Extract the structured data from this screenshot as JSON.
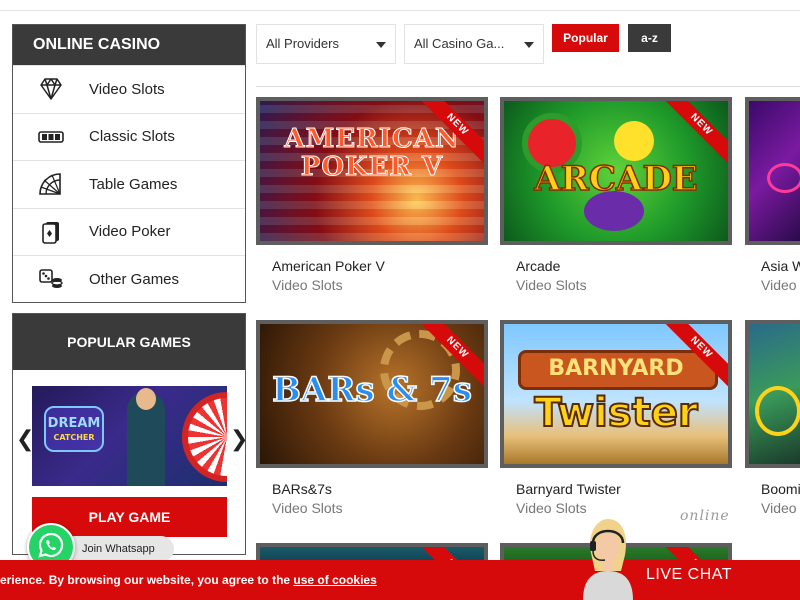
{
  "sidebar": {
    "casino_title": "ONLINE CASINO",
    "categories": [
      {
        "label": "Video Slots",
        "icon": "diamond-icon"
      },
      {
        "label": "Classic Slots",
        "icon": "slot-reels-icon"
      },
      {
        "label": "Table Games",
        "icon": "roulette-icon"
      },
      {
        "label": "Video Poker",
        "icon": "playing-card-icon"
      },
      {
        "label": "Other Games",
        "icon": "dice-chips-icon"
      }
    ],
    "popular_title": "POPULAR GAMES",
    "popular_game_logo_line1": "DREAM",
    "popular_game_logo_line2": "CATCHER",
    "play_label": "PLAY GAME"
  },
  "filters": {
    "providers_value": "All Providers",
    "games_value": "All Casino Ga...",
    "popular_label": "Popular",
    "az_label": "a-z"
  },
  "badge_text": "NEW",
  "games": [
    {
      "title": "American Poker V",
      "category": "Video Slots",
      "art": "AMERICAN POKER V"
    },
    {
      "title": "Arcade",
      "category": "Video Slots",
      "art": "ARCADE"
    },
    {
      "title": "Asia W",
      "category": "Video S"
    },
    {
      "title": "BARs&7s",
      "category": "Video Slots",
      "art": "BARs & 7s"
    },
    {
      "title": "Barnyard Twister",
      "category": "Video Slots",
      "art_top": "BARNYARD",
      "art_bottom": "Twister"
    },
    {
      "title": "Boomi",
      "category": "Video"
    }
  ],
  "whatsapp": {
    "label": "Join Whatsapp"
  },
  "cookie": {
    "text": "erience. By browsing our website, you agree to the ",
    "link": "use of cookies"
  },
  "chat": {
    "online_label": "online",
    "live_chat_label": "LIVE CHAT"
  },
  "colors": {
    "brand_red": "#d60a0a",
    "dark_header": "#3a3a3a",
    "whatsapp_green": "#25d366"
  }
}
